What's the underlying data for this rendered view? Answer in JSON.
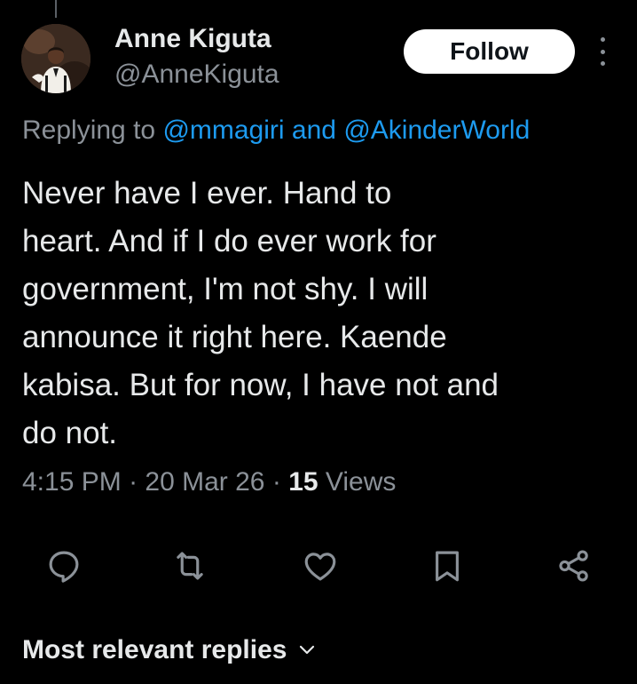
{
  "author": {
    "name": "Anne Kiguta",
    "handle": "@AnneKiguta"
  },
  "follow_label": "Follow",
  "reply_context": {
    "prefix": "Replying to",
    "mention_1": "@mmagiri",
    "connector": "and",
    "mention_2": "@AkinderWorld"
  },
  "tweet": {
    "text": "Never have I ever. Hand to\nheart. And if I do ever work for\ngovernment, I'm not shy. I will\nannounce it right here. Kaende\nkabisa. But for now, I have not and\ndo not."
  },
  "meta": {
    "time": "4:15 PM",
    "separator": "·",
    "date": "20 Mar 26",
    "views_count": "15",
    "views_label": "Views"
  },
  "actions": [
    {
      "icon": "reply-icon"
    },
    {
      "icon": "retweet-icon"
    },
    {
      "icon": "like-icon"
    },
    {
      "icon": "bookmark-icon"
    },
    {
      "icon": "share-icon"
    }
  ],
  "replies_sort": {
    "label": "Most relevant replies",
    "icon": "chevron-down-icon"
  },
  "colors": {
    "background": "#000000",
    "primary_text": "#e7e9ea",
    "secondary_text": "#8b9198",
    "link": "#1d9bf0",
    "follow_button_bg": "#ffffff"
  }
}
